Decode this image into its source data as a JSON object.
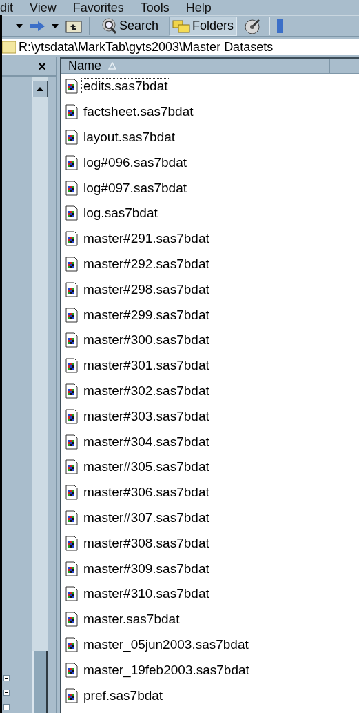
{
  "menu": [
    {
      "label": "dit"
    },
    {
      "label": "View"
    },
    {
      "label": "Favorites"
    },
    {
      "label": "Tools"
    },
    {
      "label": "Help"
    }
  ],
  "toolbar": [
    {
      "kind": "caret"
    },
    {
      "kind": "forward"
    },
    {
      "kind": "caret"
    },
    {
      "kind": "up"
    },
    {
      "kind": "separator"
    },
    {
      "kind": "search",
      "label": "Search",
      "selected": false
    },
    {
      "kind": "folders",
      "label": "Folders",
      "selected": true
    },
    {
      "kind": "history"
    },
    {
      "kind": "separator"
    },
    {
      "kind": "move"
    }
  ],
  "address": "R:\\ytsdata\\MarkTab\\gyts2003\\Master Datasets",
  "pane_close": "×",
  "tree_nodes": [
    {
      "expanded": true
    },
    {
      "expanded": true
    },
    {
      "expanded": true
    }
  ],
  "file_list": {
    "column": {
      "label": "Name",
      "sorted": true
    },
    "files": [
      {
        "name": "edits.sas7bdat",
        "selected": true
      },
      {
        "name": "factsheet.sas7bdat",
        "selected": false
      },
      {
        "name": "layout.sas7bdat",
        "selected": false
      },
      {
        "name": "log#096.sas7bdat",
        "selected": false
      },
      {
        "name": "log#097.sas7bdat",
        "selected": false
      },
      {
        "name": "log.sas7bdat",
        "selected": false
      },
      {
        "name": "master#291.sas7bdat",
        "selected": false
      },
      {
        "name": "master#292.sas7bdat",
        "selected": false
      },
      {
        "name": "master#298.sas7bdat",
        "selected": false
      },
      {
        "name": "master#299.sas7bdat",
        "selected": false
      },
      {
        "name": "master#300.sas7bdat",
        "selected": false
      },
      {
        "name": "master#301.sas7bdat",
        "selected": false
      },
      {
        "name": "master#302.sas7bdat",
        "selected": false
      },
      {
        "name": "master#303.sas7bdat",
        "selected": false
      },
      {
        "name": "master#304.sas7bdat",
        "selected": false
      },
      {
        "name": "master#305.sas7bdat",
        "selected": false
      },
      {
        "name": "master#306.sas7bdat",
        "selected": false
      },
      {
        "name": "master#307.sas7bdat",
        "selected": false
      },
      {
        "name": "master#308.sas7bdat",
        "selected": false
      },
      {
        "name": "master#309.sas7bdat",
        "selected": false
      },
      {
        "name": "master#310.sas7bdat",
        "selected": false
      },
      {
        "name": "master.sas7bdat",
        "selected": false
      },
      {
        "name": "master_05jun2003.sas7bdat",
        "selected": false
      },
      {
        "name": "master_19feb2003.sas7bdat",
        "selected": false
      },
      {
        "name": "pref.sas7bdat",
        "selected": false
      }
    ]
  }
}
